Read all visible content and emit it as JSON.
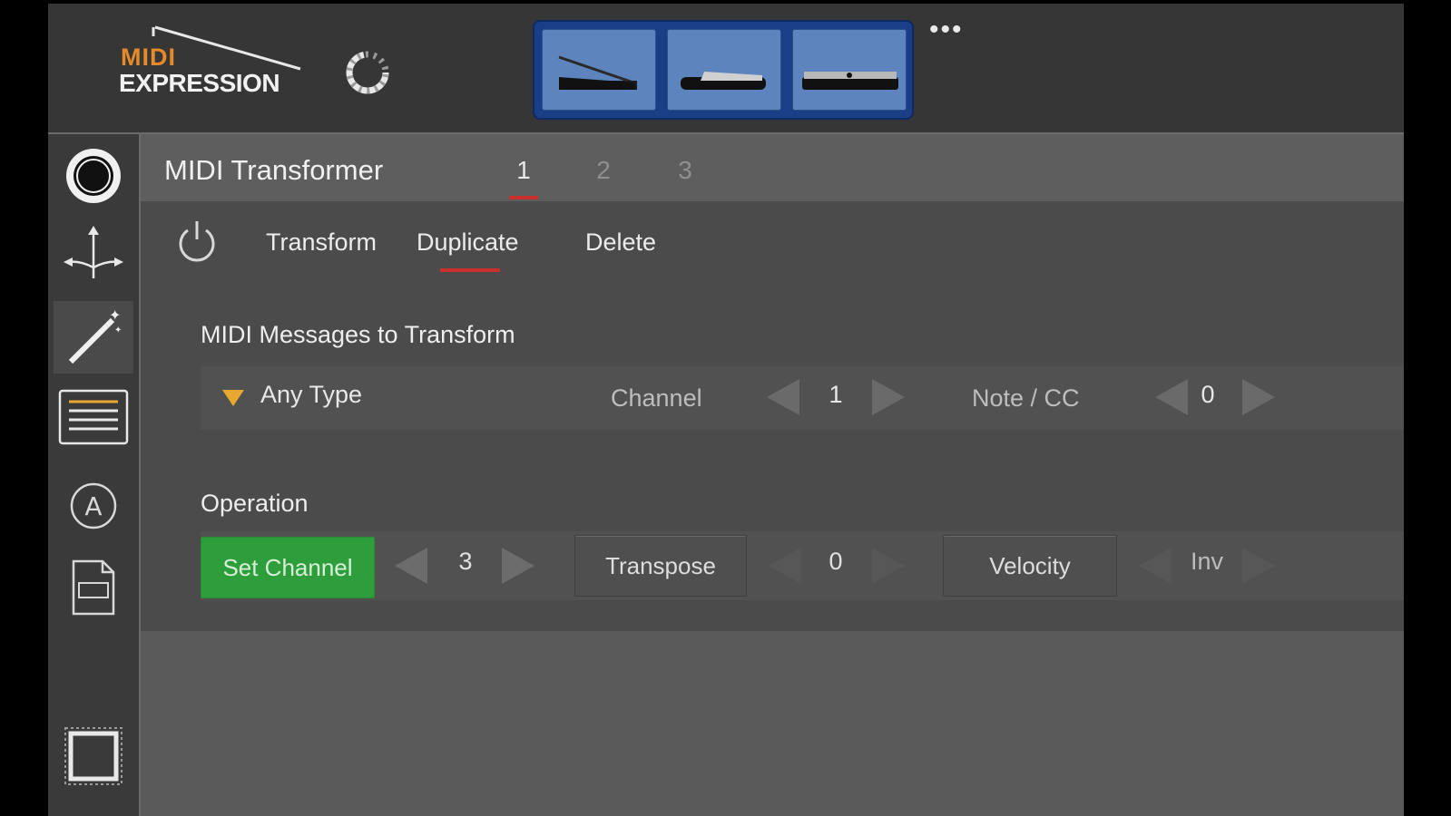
{
  "app": {
    "logo_line1": "MIDI",
    "logo_line2": "EXPRESSION",
    "more_label": "•••"
  },
  "sidebar": {
    "items": [
      {
        "icon": "record-circle-icon"
      },
      {
        "icon": "split-arrows-icon"
      },
      {
        "icon": "magic-wand-icon",
        "active": true
      },
      {
        "icon": "list-icon"
      },
      {
        "icon": "circle-a-icon"
      },
      {
        "icon": "pdf-document-icon"
      },
      {
        "icon": "chip-icon"
      }
    ]
  },
  "page": {
    "title": "MIDI Transformer",
    "tabs": [
      {
        "label": "1",
        "active": true
      },
      {
        "label": "2"
      },
      {
        "label": "3"
      }
    ]
  },
  "actions": {
    "transform": "Transform",
    "duplicate": "Duplicate",
    "delete": "Delete"
  },
  "messages": {
    "label": "MIDI Messages to Transform",
    "type_value": "Any Type",
    "channel_label": "Channel",
    "channel_value": "1",
    "note_label": "Note / CC",
    "note_value": "0"
  },
  "operation": {
    "label": "Operation",
    "set_channel_label": "Set Channel",
    "set_channel_value": "3",
    "transpose_label": "Transpose",
    "transpose_value": "0",
    "velocity_label": "Velocity",
    "velocity_value": "Inv"
  },
  "colors": {
    "accent_red": "#c9302c",
    "active_green": "#2e9e3c",
    "pedal_blue": "#5e84bd",
    "logo_orange": "#e58a2a"
  }
}
